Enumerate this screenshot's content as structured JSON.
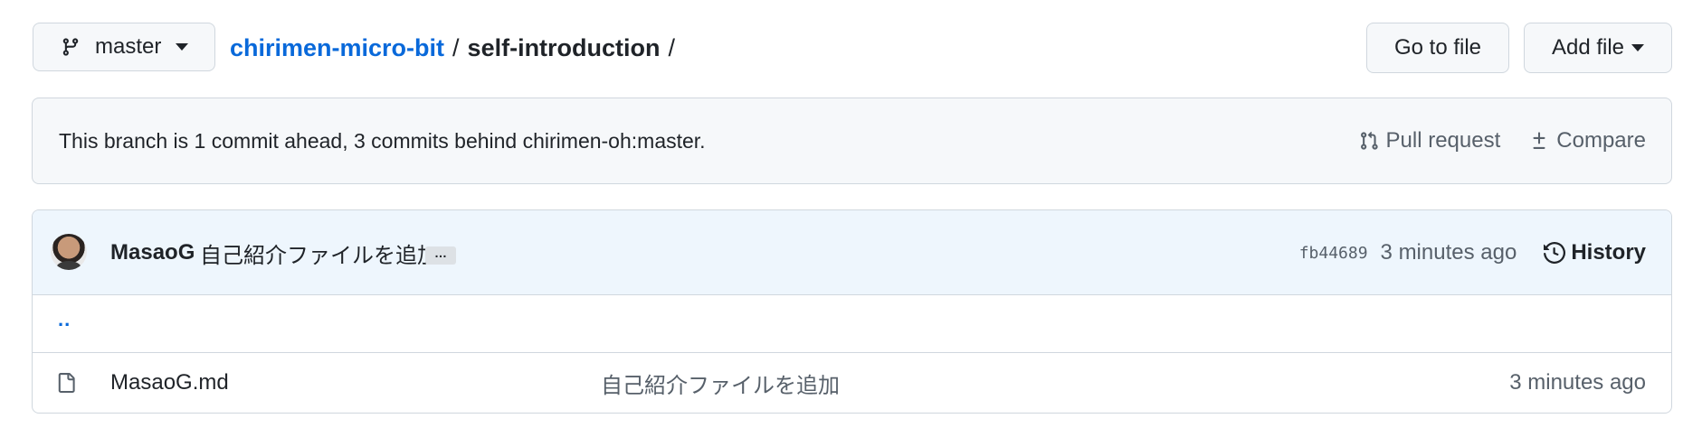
{
  "branch": {
    "name": "master",
    "icon": "git-branch-icon"
  },
  "breadcrumb": {
    "repo": "chirimen-micro-bit",
    "separator": "/",
    "directory": "self-introduction",
    "trailing_separator": "/"
  },
  "actions": {
    "go_to_file": "Go to file",
    "add_file": "Add file"
  },
  "branch_status": {
    "text": "This branch is 1 commit ahead, 3 commits behind chirimen-oh:master.",
    "pull_request": "Pull request",
    "compare": "Compare"
  },
  "latest_commit": {
    "author": "MasaoG",
    "message": "自己紹介ファイルを追加",
    "ellipsis": "…",
    "sha": "fb44689",
    "time": "3 minutes ago",
    "history": "History"
  },
  "parent_dir": "..",
  "files": [
    {
      "name": "MasaoG.md",
      "commit_message": "自己紹介ファイルを追加",
      "time": "3 minutes ago",
      "icon": "file-icon"
    }
  ],
  "colors": {
    "link": "#0969da",
    "muted": "#57606a",
    "border": "#d0d7de",
    "commit_row_bg": "#eef6fd",
    "box_bg": "#f6f8fa"
  }
}
